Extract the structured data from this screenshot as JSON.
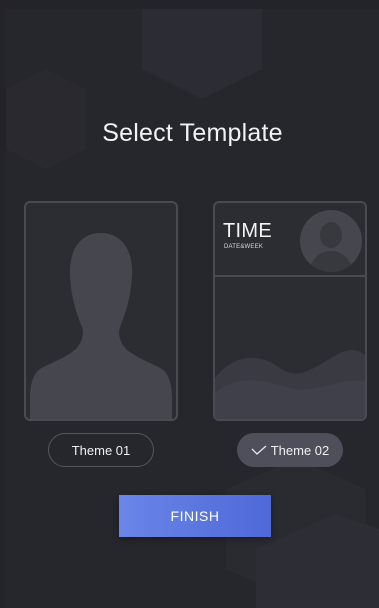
{
  "page": {
    "title": "Select Template",
    "finish_label": "FINISH"
  },
  "templates": [
    {
      "label": "Theme 01",
      "selected": false
    },
    {
      "label": "Theme 02",
      "selected": true,
      "time_label": "TIME",
      "date_label": "DATE&WEEK"
    }
  ],
  "colors": {
    "background": "#26262d",
    "card_border": "#4a4a52",
    "silhouette": "#46464e",
    "selected_pill": "#4f4f5c",
    "finish_gradient_start": "#6a86e8",
    "finish_gradient_end": "#4f68d8"
  },
  "icons": {
    "selected_indicator": "checkmark-icon"
  }
}
